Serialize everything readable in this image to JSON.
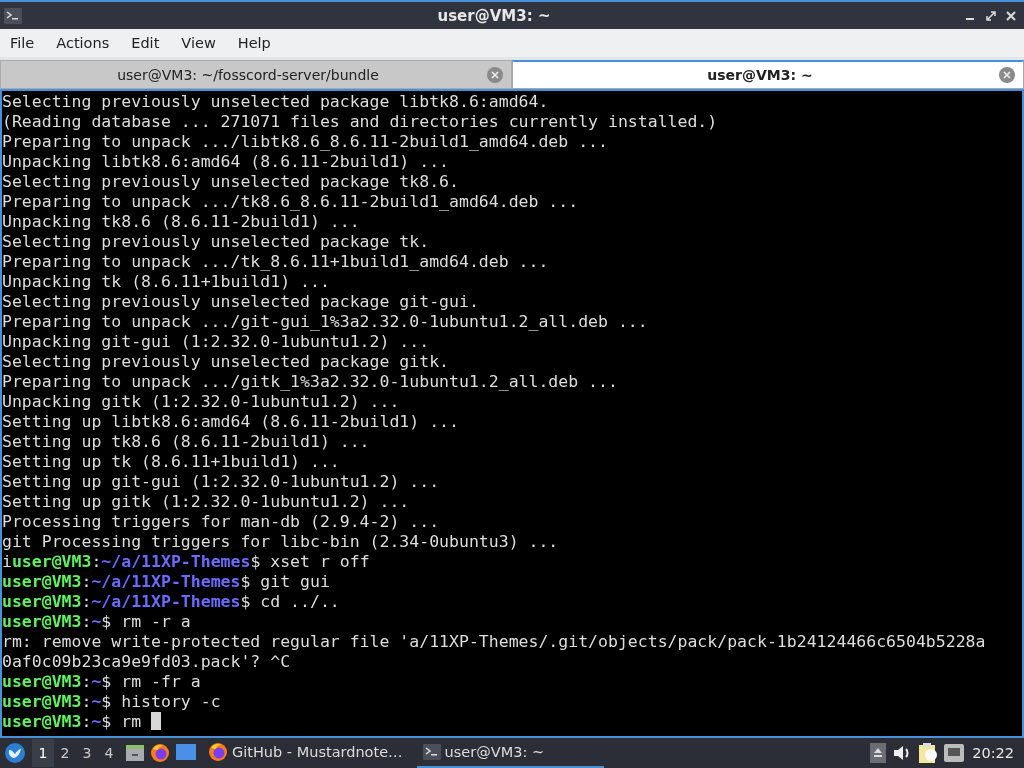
{
  "window": {
    "title": "user@VM3: ~"
  },
  "menu": [
    "File",
    "Actions",
    "Edit",
    "View",
    "Help"
  ],
  "tabs": [
    {
      "label": "user@VM3: ~/fosscord-server/bundle",
      "selected": false
    },
    {
      "label": "user@VM3: ~",
      "selected": true
    }
  ],
  "terminal": {
    "lines": [
      {
        "kind": "output",
        "text": "Selecting previously unselected package libtk8.6:amd64."
      },
      {
        "kind": "output",
        "text": "(Reading database ... 271071 files and directories currently installed.)"
      },
      {
        "kind": "output",
        "text": "Preparing to unpack .../libtk8.6_8.6.11-2build1_amd64.deb ..."
      },
      {
        "kind": "output",
        "text": "Unpacking libtk8.6:amd64 (8.6.11-2build1) ..."
      },
      {
        "kind": "output",
        "text": "Selecting previously unselected package tk8.6."
      },
      {
        "kind": "output",
        "text": "Preparing to unpack .../tk8.6_8.6.11-2build1_amd64.deb ..."
      },
      {
        "kind": "output",
        "text": "Unpacking tk8.6 (8.6.11-2build1) ..."
      },
      {
        "kind": "output",
        "text": "Selecting previously unselected package tk."
      },
      {
        "kind": "output",
        "text": "Preparing to unpack .../tk_8.6.11+1build1_amd64.deb ..."
      },
      {
        "kind": "output",
        "text": "Unpacking tk (8.6.11+1build1) ..."
      },
      {
        "kind": "output",
        "text": "Selecting previously unselected package git-gui."
      },
      {
        "kind": "output",
        "text": "Preparing to unpack .../git-gui_1%3a2.32.0-1ubuntu1.2_all.deb ..."
      },
      {
        "kind": "output",
        "text": "Unpacking git-gui (1:2.32.0-1ubuntu1.2) ..."
      },
      {
        "kind": "output",
        "text": "Selecting previously unselected package gitk."
      },
      {
        "kind": "output",
        "text": "Preparing to unpack .../gitk_1%3a2.32.0-1ubuntu1.2_all.deb ..."
      },
      {
        "kind": "output",
        "text": "Unpacking gitk (1:2.32.0-1ubuntu1.2) ..."
      },
      {
        "kind": "output",
        "text": "Setting up libtk8.6:amd64 (8.6.11-2build1) ..."
      },
      {
        "kind": "output",
        "text": "Setting up tk8.6 (8.6.11-2build1) ..."
      },
      {
        "kind": "output",
        "text": "Setting up tk (8.6.11+1build1) ..."
      },
      {
        "kind": "output",
        "text": "Setting up git-gui (1:2.32.0-1ubuntu1.2) ..."
      },
      {
        "kind": "output",
        "text": "Setting up gitk (1:2.32.0-1ubuntu1.2) ..."
      },
      {
        "kind": "output",
        "text": "Processing triggers for man-db (2.9.4-2) ..."
      },
      {
        "kind": "output",
        "text": "git Processing triggers for libc-bin (2.34-0ubuntu3) ..."
      },
      {
        "kind": "prompt",
        "prefix": "i",
        "user": "user@VM3",
        "separator": ":",
        "path": "~/a/11XP-Themes",
        "command": "$ xset r off"
      },
      {
        "kind": "prompt",
        "user": "user@VM3",
        "separator": ":",
        "path": "~/a/11XP-Themes",
        "command": "$ git gui"
      },
      {
        "kind": "prompt",
        "user": "user@VM3",
        "separator": ":",
        "path": "~/a/11XP-Themes",
        "command": "$ cd ../.."
      },
      {
        "kind": "prompt",
        "user": "user@VM3",
        "separator": ":",
        "path": "~",
        "command": "$ rm -r a"
      },
      {
        "kind": "output",
        "text": "rm: remove write-protected regular file 'a/11XP-Themes/.git/objects/pack/pack-1b24124466c6504b5228a"
      },
      {
        "kind": "output",
        "text": "0af0c09b23ca9e9fd03.pack'? ^C"
      },
      {
        "kind": "prompt",
        "user": "user@VM3",
        "separator": ":",
        "path": "~",
        "command": "$ rm -fr a"
      },
      {
        "kind": "prompt",
        "user": "user@VM3",
        "separator": ":",
        "path": "~",
        "command": "$ history -c"
      },
      {
        "kind": "prompt",
        "user": "user@VM3",
        "separator": ":",
        "path": "~",
        "command": "$ rm",
        "cursor": true
      }
    ]
  },
  "taskbar": {
    "workspaces": [
      {
        "label": "1",
        "selected": true
      },
      {
        "label": "2",
        "selected": false
      },
      {
        "label": "3",
        "selected": false
      },
      {
        "label": "4",
        "selected": false
      }
    ],
    "tasks": [
      {
        "kind": "browser",
        "label": "GitHub - Mustardnote…",
        "selected": false
      },
      {
        "kind": "terminal",
        "label": "user@VM3: ~",
        "selected": true
      }
    ],
    "clock": "20:22"
  }
}
